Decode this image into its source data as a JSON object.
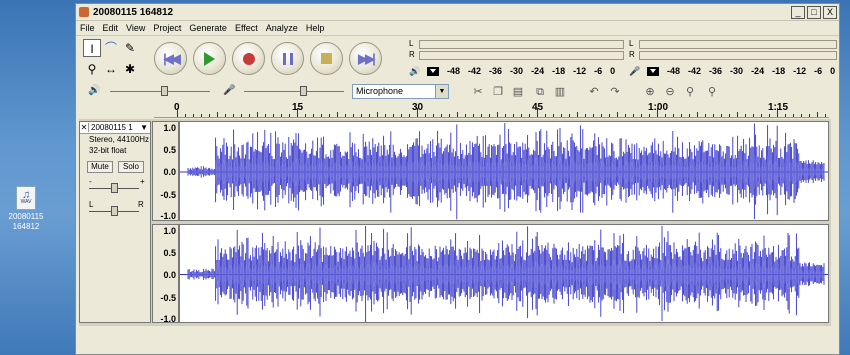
{
  "desktop": {
    "icon_label_line1": "20080115",
    "icon_label_line2": "164812",
    "icon_name": "wav-file-icon"
  },
  "window": {
    "title": "20080115 164812",
    "buttons": [
      "_",
      "□",
      "X"
    ]
  },
  "menu": [
    "File",
    "Edit",
    "View",
    "Project",
    "Generate",
    "Effect",
    "Analyze",
    "Help"
  ],
  "tools": {
    "icons": [
      "selection-tool-icon",
      "envelope-tool-icon",
      "draw-tool-icon",
      "zoom-tool-icon",
      "timeshift-tool-icon",
      "multi-tool-icon"
    ]
  },
  "transport": {
    "icons": [
      "skip-to-start-icon",
      "play-icon",
      "record-icon",
      "pause-icon",
      "stop-icon",
      "skip-to-end-icon"
    ]
  },
  "meters": {
    "playback": {
      "l": "L",
      "r": "R",
      "scale": [
        "-48",
        "-42",
        "-36",
        "-30",
        "-24",
        "-18",
        "-12",
        "-6",
        "0"
      ]
    },
    "record": {
      "l": "L",
      "r": "R",
      "scale": [
        "-48",
        "-42",
        "-36",
        "-30",
        "-24",
        "-18",
        "-12",
        "-6",
        "0"
      ]
    }
  },
  "mixer": {
    "output_level": 0.55,
    "input_level": 0.6,
    "input_source": "Microphone"
  },
  "ruler": {
    "labels": [
      "0",
      "15",
      "30",
      "45",
      "1:00",
      "1:15"
    ]
  },
  "track": {
    "name": "20080115 1",
    "format": "Stereo, 44100Hz",
    "bitdepth": "32-bit float",
    "mute": "Mute",
    "solo": "Solo",
    "gain_minus": "-",
    "gain_plus": "+",
    "pan_left": "L",
    "pan_right": "R",
    "scale": [
      "1.0",
      "0.5",
      "0.0",
      "-0.5",
      "-1.0"
    ]
  },
  "colors": {
    "waveform": "#3232c8",
    "waveform_rms": "#6464dc",
    "background": "#ffffff"
  }
}
